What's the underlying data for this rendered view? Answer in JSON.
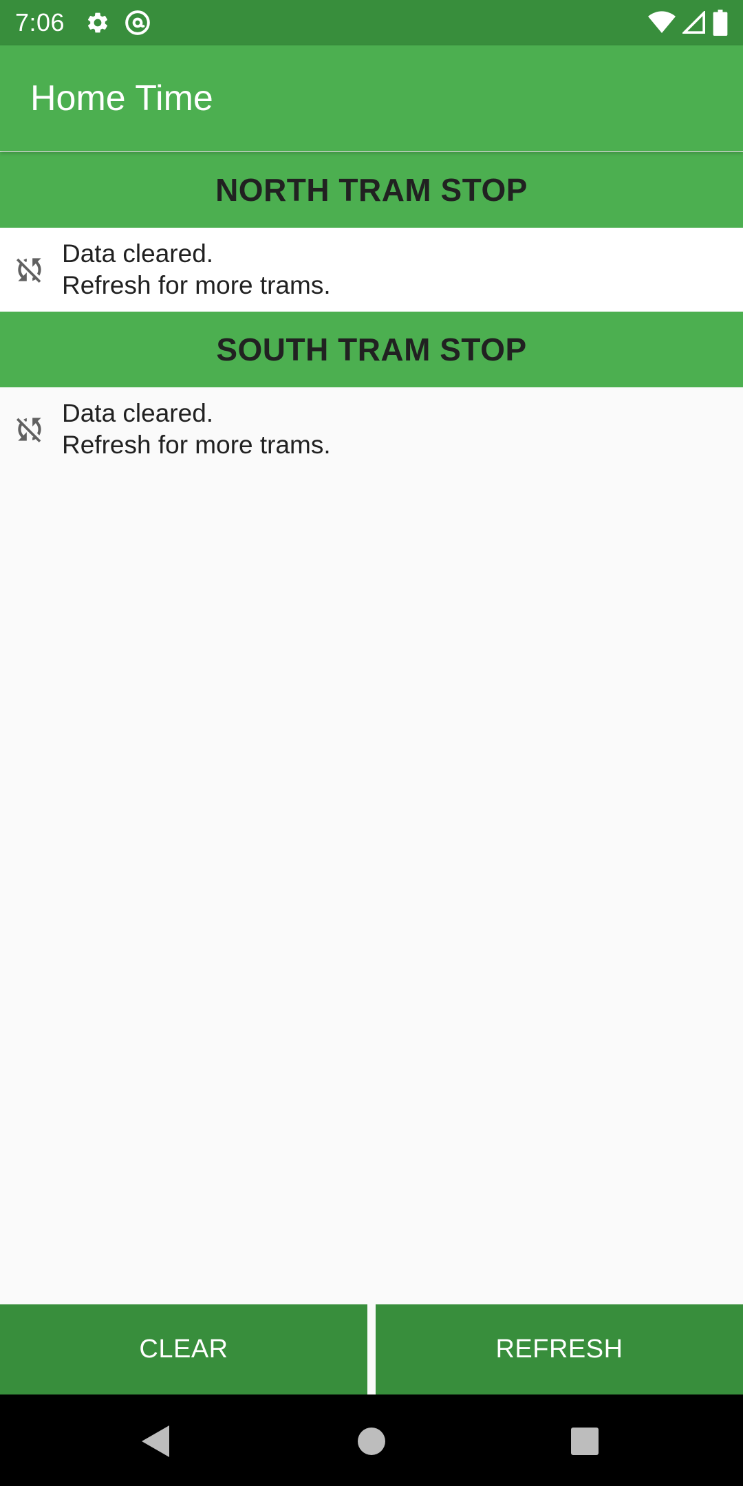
{
  "status_bar": {
    "time": "7:06",
    "left_icons": [
      "gear-icon",
      "at-sign-icon"
    ],
    "right_icons": [
      "wifi-icon",
      "signal-icon",
      "battery-icon"
    ]
  },
  "app_bar": {
    "title": "Home Time"
  },
  "sections": [
    {
      "header": "NORTH TRAM STOP",
      "icon": "sync-disabled-icon",
      "message_line1": "Data cleared.",
      "message_line2": "Refresh for more trams."
    },
    {
      "header": "SOUTH TRAM STOP",
      "icon": "sync-disabled-icon",
      "message_line1": "Data cleared.",
      "message_line2": "Refresh for more trams."
    }
  ],
  "buttons": {
    "clear_label": "CLEAR",
    "refresh_label": "REFRESH"
  },
  "nav_bar": {
    "icons": [
      "back-icon",
      "home-icon",
      "recents-icon"
    ]
  },
  "colors": {
    "primary": "#4caf50",
    "primary_dark": "#388e3c",
    "background": "#fafafa",
    "text": "#212121"
  }
}
